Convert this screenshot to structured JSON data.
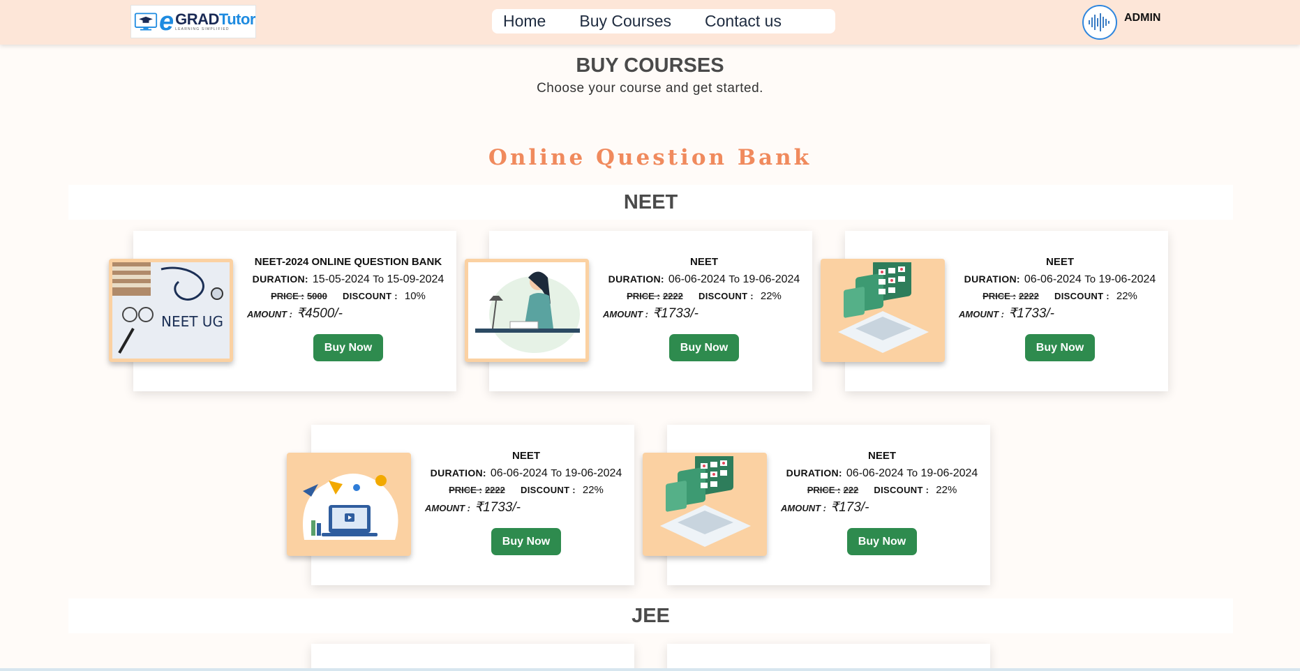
{
  "header": {
    "logo": {
      "e": "e",
      "grad": "GRAD",
      "tutor": "Tutor",
      "tagline": "LEARNING SIMPLIFIED"
    },
    "nav": [
      {
        "label": "Home"
      },
      {
        "label": "Buy Courses"
      },
      {
        "label": "Contact us"
      }
    ],
    "user": {
      "name": "ADMIN"
    }
  },
  "page": {
    "title": "BUY COURSES",
    "subtitle": "Choose your course and get started."
  },
  "section": {
    "title": "Online Question Bank"
  },
  "categories": [
    "NEET",
    "JEE"
  ],
  "labels": {
    "duration": "DURATION:",
    "to": "To",
    "price": "PRICE :",
    "discount": "DISCOUNT :",
    "amount": "AMOUNT :",
    "buy": "Buy Now"
  },
  "courses": [
    {
      "title": "NEET-2024 ONLINE QUESTION BANK",
      "start": "15-05-2024",
      "end": "15-09-2024",
      "price": "5000",
      "discount": "10%",
      "amount": "₹4500/-",
      "image": "neet-ug-photo"
    },
    {
      "title": "NEET",
      "start": "06-06-2024",
      "end": "19-06-2024",
      "price": "2222",
      "discount": "22%",
      "amount": "₹1733/-",
      "image": "student-studying-illustration"
    },
    {
      "title": "NEET",
      "start": "06-06-2024",
      "end": "19-06-2024",
      "price": "2222",
      "discount": "22%",
      "amount": "₹1733/-",
      "image": "online-test-illustration"
    },
    {
      "title": "NEET",
      "start": "06-06-2024",
      "end": "19-06-2024",
      "price": "2222",
      "discount": "22%",
      "amount": "₹1733/-",
      "image": "online-learning-illustration"
    },
    {
      "title": "NEET",
      "start": "06-06-2024",
      "end": "19-06-2024",
      "price": "222",
      "discount": "22%",
      "amount": "₹173/-",
      "image": "online-test-illustration"
    }
  ],
  "colors": {
    "header_bg": "#fde6d8",
    "accent": "#f08a5d",
    "buy_button": "#2e8b4e",
    "thumb_border": "#fbd1a2"
  }
}
